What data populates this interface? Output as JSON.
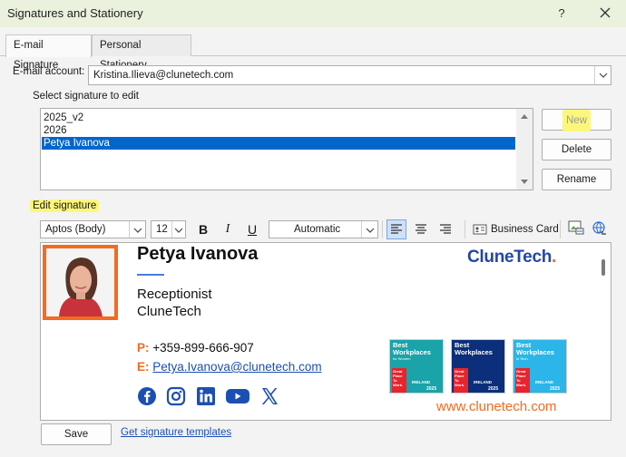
{
  "window": {
    "title": "Signatures and Stationery",
    "help_label": "?"
  },
  "tabs": [
    {
      "label": "E-mail Signature",
      "active": true
    },
    {
      "label": "Personal Stationery",
      "active": false
    }
  ],
  "account": {
    "label": "E-mail account:",
    "value": "Kristina.Ilieva@clunetech.com"
  },
  "signatures": {
    "label": "Select signature to edit",
    "items": [
      {
        "name": "2025_v2",
        "selected": false
      },
      {
        "name": "2026",
        "selected": false
      },
      {
        "name": "Petya Ivanova",
        "selected": true
      }
    ],
    "buttons": {
      "new": "New",
      "delete": "Delete",
      "rename": "Rename"
    }
  },
  "editor": {
    "label": "Edit signature",
    "font": "Aptos (Body)",
    "size": "12",
    "bold": "B",
    "italic": "I",
    "underline": "U",
    "color": "Automatic",
    "business_card": "Business Card"
  },
  "signature": {
    "name": "Petya Ivanova",
    "role": "Receptionist",
    "company": "CluneTech",
    "brand": "CluneTech",
    "brand_dot": ".",
    "phone_key": "P:",
    "phone": "+359-899-666-907",
    "email_key": "E:",
    "email": "Petya.Ivanova@clunetech.com",
    "website": "www.clunetech.com",
    "socials": [
      "facebook-icon",
      "instagram-icon",
      "linkedin-icon",
      "youtube-icon",
      "x-icon"
    ],
    "badges": [
      {
        "line1": "Best",
        "line2": "Workplaces",
        "sub": "for Women",
        "cert": "Great Place To Work.",
        "region": "IRELAND",
        "year": "2025",
        "color": "#1aa3a8"
      },
      {
        "line1": "Best",
        "line2": "Workplaces",
        "sub": "",
        "cert": "Great Place To Work.",
        "region": "IRELAND",
        "year": "2025",
        "color": "#0b2f7a"
      },
      {
        "line1": "Best",
        "line2": "Workplaces",
        "sub": "in Tech",
        "cert": "Great Place To Work.",
        "region": "IRELAND",
        "year": "2025",
        "color": "#2bb5e8"
      }
    ]
  },
  "footer": {
    "save": "Save",
    "templates_link": "Get signature templates"
  },
  "colors": {
    "titlebar": "#eaf1dc",
    "selection": "#0066cc",
    "highlight": "#fcf77a",
    "brand_orange": "#f26b21",
    "brand_blue": "#2346a8"
  }
}
